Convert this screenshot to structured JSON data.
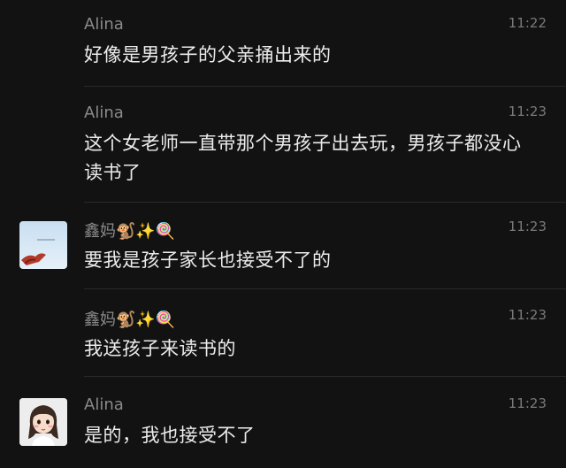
{
  "messages": [
    {
      "sender": "Alina",
      "time": "11:22",
      "text": "好像是男孩子的父亲捅出来的",
      "avatar": null
    },
    {
      "sender": "Alina",
      "time": "11:23",
      "text": "这个女老师一直带那个男孩子出去玩，男孩子都没心读书了",
      "avatar": null
    },
    {
      "sender": "鑫妈🐒✨🍭",
      "time": "11:23",
      "text": "要我是孩子家长也接受不了的",
      "avatar": "sky-photo"
    },
    {
      "sender": "鑫妈🐒✨🍭",
      "time": "11:23",
      "text": "我送孩子来读书的",
      "avatar": null
    },
    {
      "sender": "Alina",
      "time": "11:23",
      "text": "是的，我也接受不了",
      "avatar": "cartoon-girl"
    }
  ]
}
